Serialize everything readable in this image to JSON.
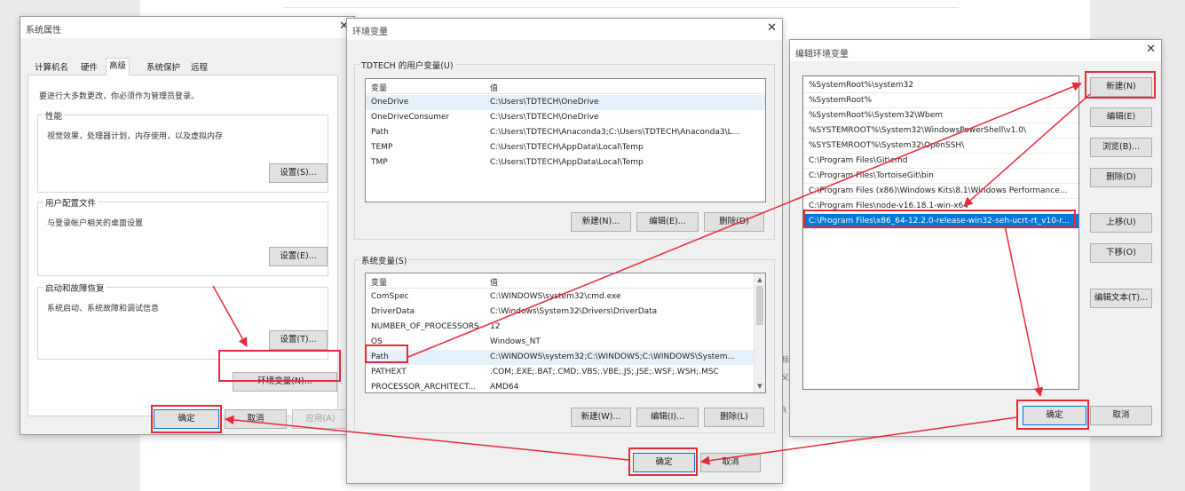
{
  "background": {
    "snippet_lines": [
      "标",
      "义",
      "R"
    ]
  },
  "system_properties": {
    "title": "系统属性",
    "tabs": [
      "计算机名",
      "硬件",
      "高级",
      "系统保护",
      "远程"
    ],
    "active_tab": "高级",
    "admin_note": "要进行大多数更改，你必须作为管理员登录。",
    "performance": {
      "title": "性能",
      "desc": "视觉效果，处理器计划，内存使用，以及虚拟内存",
      "button": "设置(S)..."
    },
    "user_profiles": {
      "title": "用户配置文件",
      "desc": "与登录帐户相关的桌面设置",
      "button": "设置(E)..."
    },
    "startup_recovery": {
      "title": "启动和故障恢复",
      "desc": "系统启动、系统故障和调试信息",
      "button": "设置(T)..."
    },
    "env_button": "环境变量(N)...",
    "ok": "确定",
    "cancel": "取消",
    "apply": "应用(A)"
  },
  "env_vars": {
    "title": "环境变量",
    "user_section": "TDTECH 的用户变量(U)",
    "system_section": "系统变量(S)",
    "col_var": "变量",
    "col_val": "值",
    "user_vars": [
      {
        "name": "OneDrive",
        "value": "C:\\Users\\TDTECH\\OneDrive"
      },
      {
        "name": "OneDriveConsumer",
        "value": "C:\\Users\\TDTECH\\OneDrive"
      },
      {
        "name": "Path",
        "value": "C:\\Users\\TDTECH\\Anaconda3;C:\\Users\\TDTECH\\Anaconda3\\L..."
      },
      {
        "name": "TEMP",
        "value": "C:\\Users\\TDTECH\\AppData\\Local\\Temp"
      },
      {
        "name": "TMP",
        "value": "C:\\Users\\TDTECH\\AppData\\Local\\Temp"
      }
    ],
    "system_vars": [
      {
        "name": "ComSpec",
        "value": "C:\\WINDOWS\\system32\\cmd.exe"
      },
      {
        "name": "DriverData",
        "value": "C:\\Windows\\System32\\Drivers\\DriverData"
      },
      {
        "name": "NUMBER_OF_PROCESSORS",
        "value": "12"
      },
      {
        "name": "OS",
        "value": "Windows_NT"
      },
      {
        "name": "Path",
        "value": "C:\\WINDOWS\\system32;C:\\WINDOWS;C:\\WINDOWS\\System..."
      },
      {
        "name": "PATHEXT",
        "value": ".COM;.EXE;.BAT;.CMD;.VBS;.VBE;.JS;.JSE;.WSF;.WSH;.MSC"
      },
      {
        "name": "PROCESSOR_ARCHITECT...",
        "value": "AMD64"
      }
    ],
    "user_buttons": {
      "new": "新建(N)...",
      "edit": "编辑(E)...",
      "delete": "删除(D)"
    },
    "system_buttons": {
      "new": "新建(W)...",
      "edit": "编辑(I)...",
      "delete": "删除(L)"
    },
    "ok": "确定",
    "cancel": "取消"
  },
  "edit_env": {
    "title": "编辑环境变量",
    "paths": [
      "%SystemRoot%\\system32",
      "%SystemRoot%",
      "%SystemRoot%\\System32\\Wbem",
      "%SYSTEMROOT%\\System32\\WindowsPowerShell\\v1.0\\",
      "%SYSTEMROOT%\\System32\\OpenSSH\\",
      "C:\\Program Files\\Git\\cmd",
      "C:\\Program Files\\TortoiseGit\\bin",
      "C:\\Program Files (x86)\\Windows Kits\\8.1\\Windows Performance...",
      "C:\\Program Files\\node-v16.18.1-win-x64",
      "C:\\Program Files\\x86_64-12.2.0-release-win32-seh-ucrt-rt_v10-r..."
    ],
    "buttons": {
      "new": "新建(N)",
      "edit": "编辑(E)",
      "browse": "浏览(B)...",
      "delete": "删除(D)",
      "up": "上移(U)",
      "down": "下移(O)",
      "edit_text": "编辑文本(T)..."
    },
    "ok": "确定",
    "cancel": "取消"
  }
}
